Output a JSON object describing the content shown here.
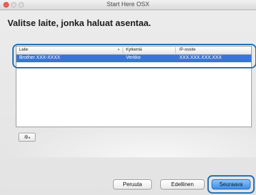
{
  "window": {
    "title": "Start Here OSX"
  },
  "heading": "Valitse laite, jonka haluat asentaa.",
  "table": {
    "columns": [
      "Laite",
      "Kytkentä",
      "IP-osoite"
    ],
    "rows": [
      {
        "device": "Brother XXX-XXXX",
        "connection": "Verkko",
        "ip": "XXX.XXX.XXX.XXX",
        "selected": true
      }
    ]
  },
  "buttons": {
    "cancel": "Peruuta",
    "back": "Edellinen",
    "next": "Seuraava"
  },
  "icons": {
    "sort": "sort-descending-icon",
    "gear": "gear-icon"
  },
  "colors": {
    "selection": "#3875d7",
    "callout_frame": "#1f6fb5",
    "close_button": "#f25f58"
  }
}
